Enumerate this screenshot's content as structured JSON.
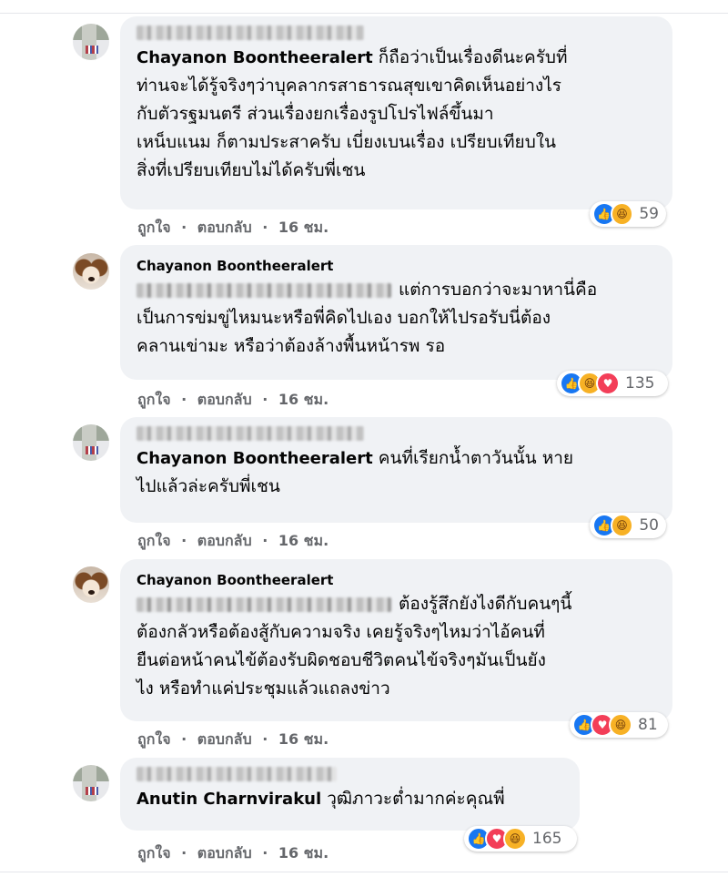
{
  "actions": {
    "like_label": "ถูกใจ",
    "reply_label": "ตอบกลับ",
    "separator": "·"
  },
  "comments": [
    {
      "author": "Chayanon Boontheeralert",
      "tag_visible_fragment": "Phacan P. Maith anothai",
      "lines": [
        "ก็ถือว่าเป็นเรื่องดีนะครับที่",
        "ท่านจะได้รู้จริงๆว่าบุคลากรสาธารณสุขเขาคิดเห็นอย่างไร",
        "กับตัวรฐมนตรี ส่วนเรื่องยกเรื่องรูปโปรไฟล์ขึ้นมา",
        "เหน็บแนม ก็ตามประสาครับ เบี่ยงเบนเรื่อง เปรียบเทียบใน",
        "สิ่งที่เปรียบเทียบไม่ได้ครับพี่เชน"
      ],
      "time": "16 ชม.",
      "reactions": [
        "like-icon",
        "haha-icon"
      ],
      "reaction_count": "59"
    },
    {
      "author": "Chayanon Boontheeralert",
      "lines": [
        "แต่การบอกว่าจะมาหานี่คือ",
        "เป็นการข่มขู่ไหมนะหรือพี่คิดไปเอง บอกให้ไปรอรับนี่ต้อง",
        "คลานเข่ามะ หรือว่าต้องล้างพื้นหน้ารพ รอ"
      ],
      "time": "16 ชม.",
      "reactions": [
        "like-icon",
        "haha-icon",
        "love-icon"
      ],
      "reaction_count": "135"
    },
    {
      "author": "Chayanon Boontheeralert",
      "tag_visible_fragment": "Phacan P. Maith anothai",
      "lines": [
        "คนที่เรียกน้ำตาวันนั้น หาย",
        "ไปแล้วล่ะครับพี่เชน"
      ],
      "time": "16 ชม.",
      "reactions": [
        "like-icon",
        "haha-icon"
      ],
      "reaction_count": "50"
    },
    {
      "author": "Chayanon Boontheeralert",
      "lines": [
        "ต้องรู้สึกยังไงดีกับคนๆนี้",
        "ต้องกลัวหรือต้องสู้กับความจริง เคยรู้จริงๆไหมว่าไอ้คนที่",
        "ยืนต่อหน้าคนไข้ต้องรับผิดชอบชีวิตคนไข้จริงๆมันเป็นยัง",
        "ไง หรือทำแค่ประชุมแล้วแถลงข่าว"
      ],
      "time": "16 ชม.",
      "reactions": [
        "like-icon",
        "love-icon",
        "haha-icon"
      ],
      "reaction_count": "81"
    },
    {
      "author": "Anutin Charnvirakul",
      "tag_visible_fragment": "Nannya Mongkolsilam",
      "lines": [
        "วุฒิภาวะต่ำมากค่ะคุณพี่"
      ],
      "time": "16 ชม.",
      "reactions": [
        "like-icon",
        "love-icon",
        "haha-icon"
      ],
      "reaction_count": "165"
    }
  ]
}
